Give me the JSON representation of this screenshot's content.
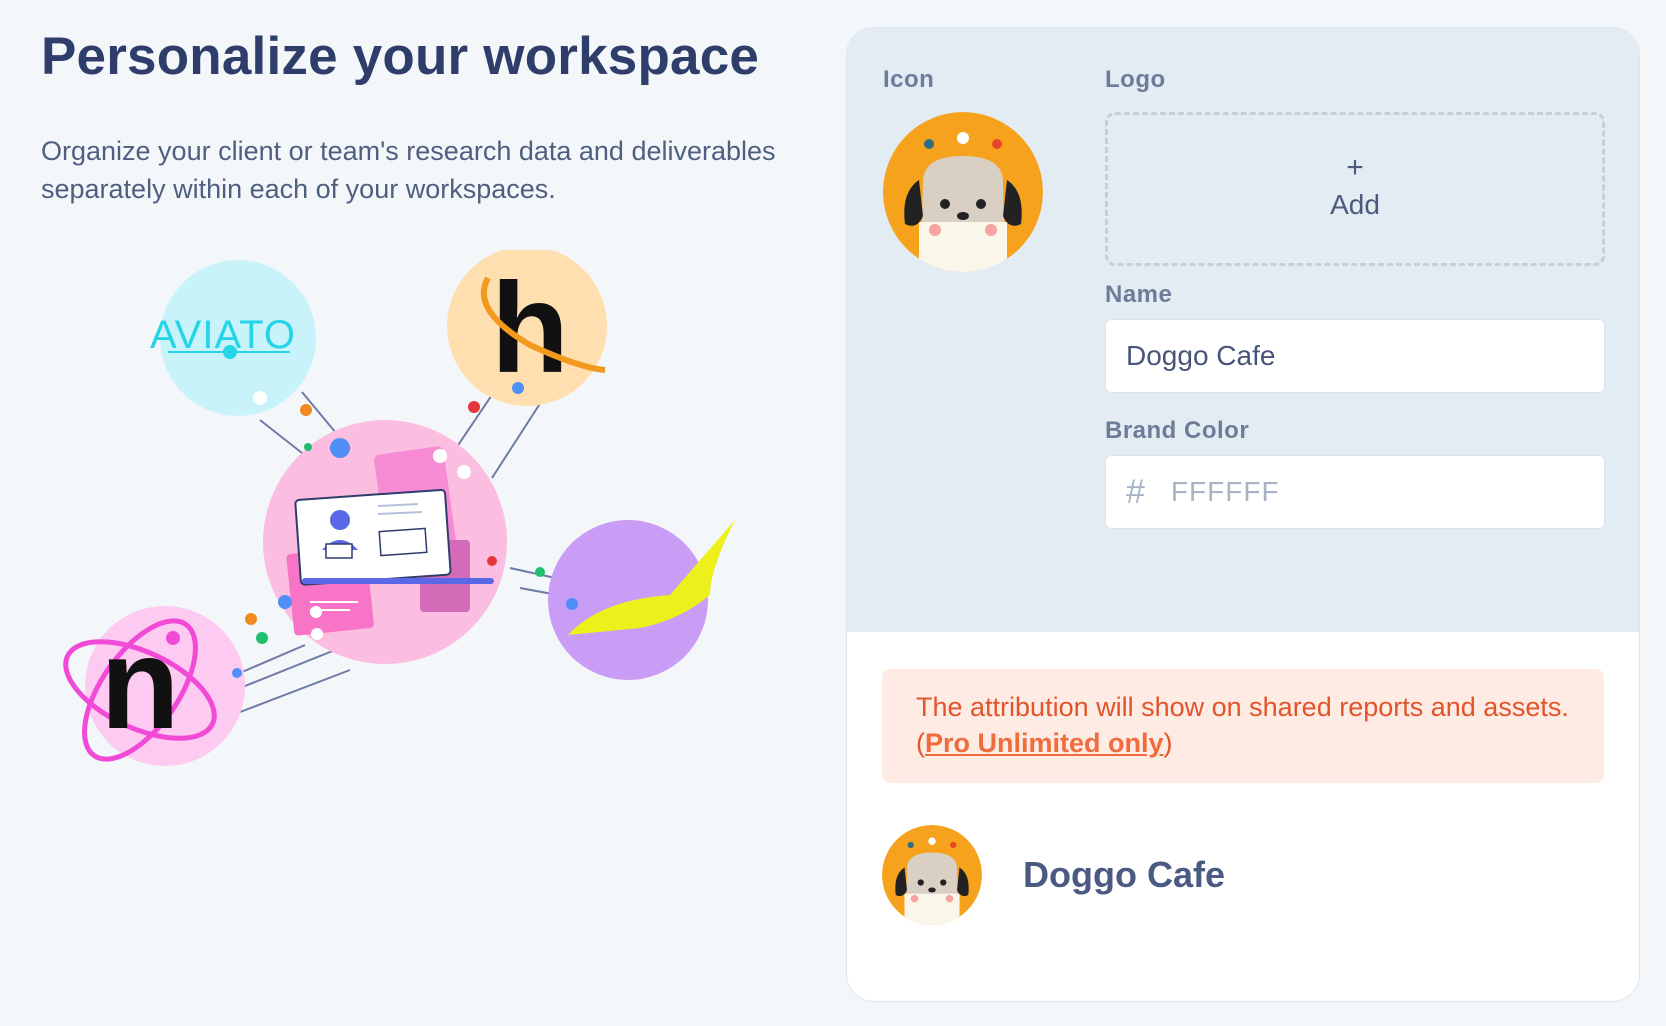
{
  "header": {
    "title": "Personalize your workspace",
    "subtitle": "Organize your client or team's research data and deliverables separately within each of your workspaces."
  },
  "illustration": {
    "logos": [
      "AVIATO",
      "h",
      "n"
    ]
  },
  "form": {
    "icon_label": "Icon",
    "logo_label": "Logo",
    "logo_add_symbol": "+",
    "logo_add_label": "Add",
    "name_label": "Name",
    "name_value": "Doggo Cafe",
    "brand_color_label": "Brand Color",
    "brand_color_prefix": "#",
    "brand_color_placeholder": "FFFFFF"
  },
  "notice": {
    "text": "The attribution will show on shared reports and assets. (",
    "link": "Pro Unlimited only",
    "suffix": ")"
  },
  "preview": {
    "name": "Doggo Cafe"
  },
  "colors": {
    "background": "#f4f7fa",
    "panel_top": "#e3ebf3",
    "notice_bg": "#fdebe4",
    "notice_text": "#e2542a",
    "title": "#2f3d6b"
  }
}
